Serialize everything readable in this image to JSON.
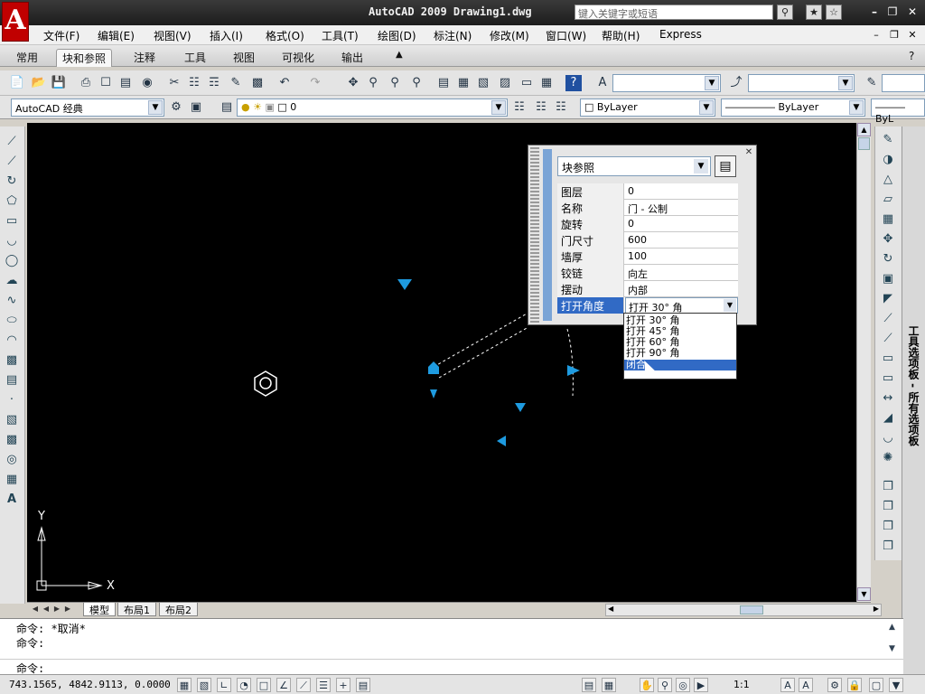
{
  "app": {
    "title": "AutoCAD 2009  Drawing1.dwg",
    "logo": "A",
    "search_placeholder": "键入关键字或短语"
  },
  "menu": [
    "文件(F)",
    "编辑(E)",
    "视图(V)",
    "插入(I)",
    "格式(O)",
    "工具(T)",
    "绘图(D)",
    "标注(N)",
    "修改(M)",
    "窗口(W)",
    "帮助(H)",
    "Express"
  ],
  "ribbon_tabs": [
    {
      "label": "常用",
      "active": false
    },
    {
      "label": "块和参照",
      "active": true
    },
    {
      "label": "注释",
      "active": false
    },
    {
      "label": "工具",
      "active": false
    },
    {
      "label": "视图",
      "active": false
    },
    {
      "label": "可视化",
      "active": false
    },
    {
      "label": "输出",
      "active": false
    }
  ],
  "toolbar2": {
    "workspace": "AutoCAD 经典",
    "layer": "0",
    "color": "ByLayer",
    "linetype": "ByLayer",
    "lineweight": "ByL"
  },
  "properties_panel": {
    "object_type": "块参照",
    "rows": [
      {
        "name": "图层",
        "value": "0"
      },
      {
        "name": "名称",
        "value": "门 - 公制"
      },
      {
        "name": "旋转",
        "value": "0"
      },
      {
        "name": "门尺寸",
        "value": "600"
      },
      {
        "name": "墙厚",
        "value": "100"
      },
      {
        "name": "铰链",
        "value": "向左"
      },
      {
        "name": "摆动",
        "value": "内部"
      },
      {
        "name": "打开角度",
        "value": "打开 30° 角"
      }
    ],
    "dropdown_options": [
      "打开 30° 角",
      "打开 45° 角",
      "打开 60° 角",
      "打开 90° 角",
      "闭合"
    ],
    "dropdown_selected": 4
  },
  "layout_tabs": [
    {
      "label": "模型",
      "active": true
    },
    {
      "label": "布局1",
      "active": false
    },
    {
      "label": "布局2",
      "active": false
    }
  ],
  "ucs": {
    "x": "X",
    "y": "Y"
  },
  "command": {
    "history": [
      "命令: *取消*",
      "命令:"
    ],
    "prompt": "命令:"
  },
  "status": {
    "coords": "743.1565,   4842.9113, 0.0000",
    "annotation_scale": "1:1"
  },
  "palette_label": "工具选项板 - 所有选项板",
  "colors": {
    "grip_blue": "#1e9be0",
    "canvas_bg": "#000000",
    "selection_blue": "#316ac5"
  }
}
